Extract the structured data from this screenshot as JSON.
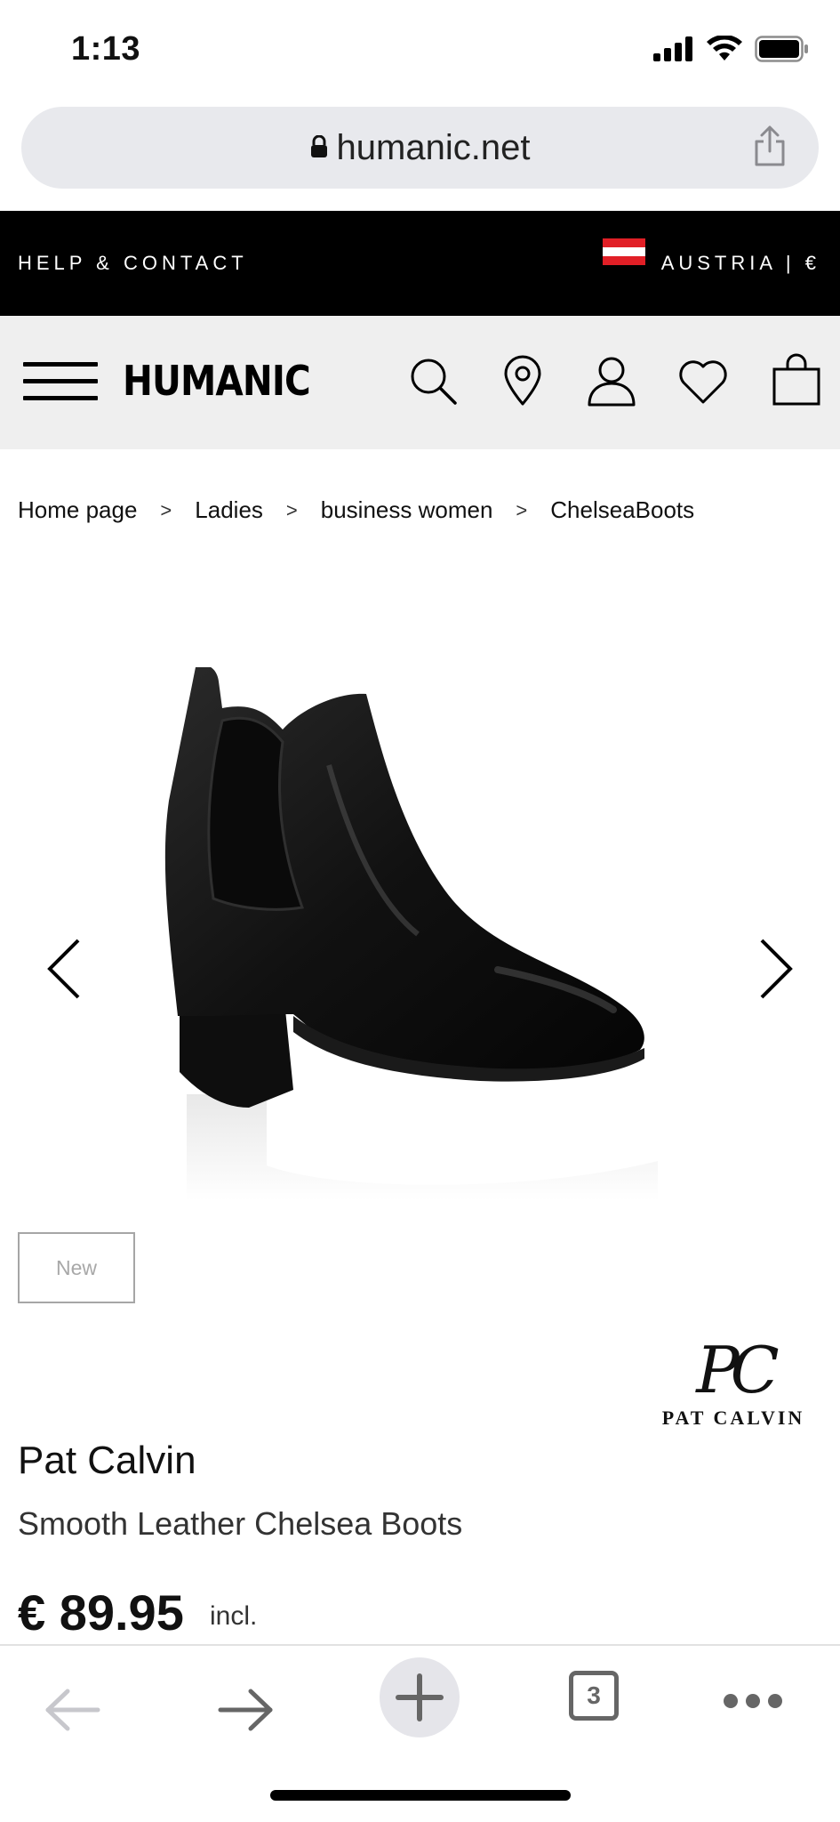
{
  "status_bar": {
    "time": "1:13"
  },
  "browser": {
    "url": "humanic.net"
  },
  "promo": {
    "help_label": "HELP & CONTACT",
    "country_label": "AUSTRIA | €",
    "flag_colors": [
      "#e11f26",
      "#ffffff",
      "#e11f26"
    ]
  },
  "header": {
    "logo_text": "HUMANIC"
  },
  "breadcrumb": [
    {
      "label": "Home page"
    },
    {
      "label": "Ladies"
    },
    {
      "label": "business women"
    },
    {
      "label": "ChelseaBoots"
    }
  ],
  "breadcrumb_separator": ">",
  "product": {
    "badge": "New",
    "brand_monogram": "PC",
    "brand_wordmark": "PAT CALVIN",
    "brand": "Pat Calvin",
    "name": "Smooth Leather Chelsea Boots",
    "price": "€ 89.95",
    "price_note": "incl."
  },
  "toolbar": {
    "tab_count": "3"
  },
  "icons": {
    "status": [
      "signal-icon",
      "wifi-icon",
      "battery-icon"
    ],
    "header": [
      "search-icon",
      "location-pin-icon",
      "user-icon",
      "heart-icon",
      "shopping-bag-icon"
    ],
    "toolbar": [
      "back-arrow-icon",
      "forward-arrow-icon",
      "new-tab-plus-icon",
      "tabs-icon",
      "more-icon"
    ]
  }
}
